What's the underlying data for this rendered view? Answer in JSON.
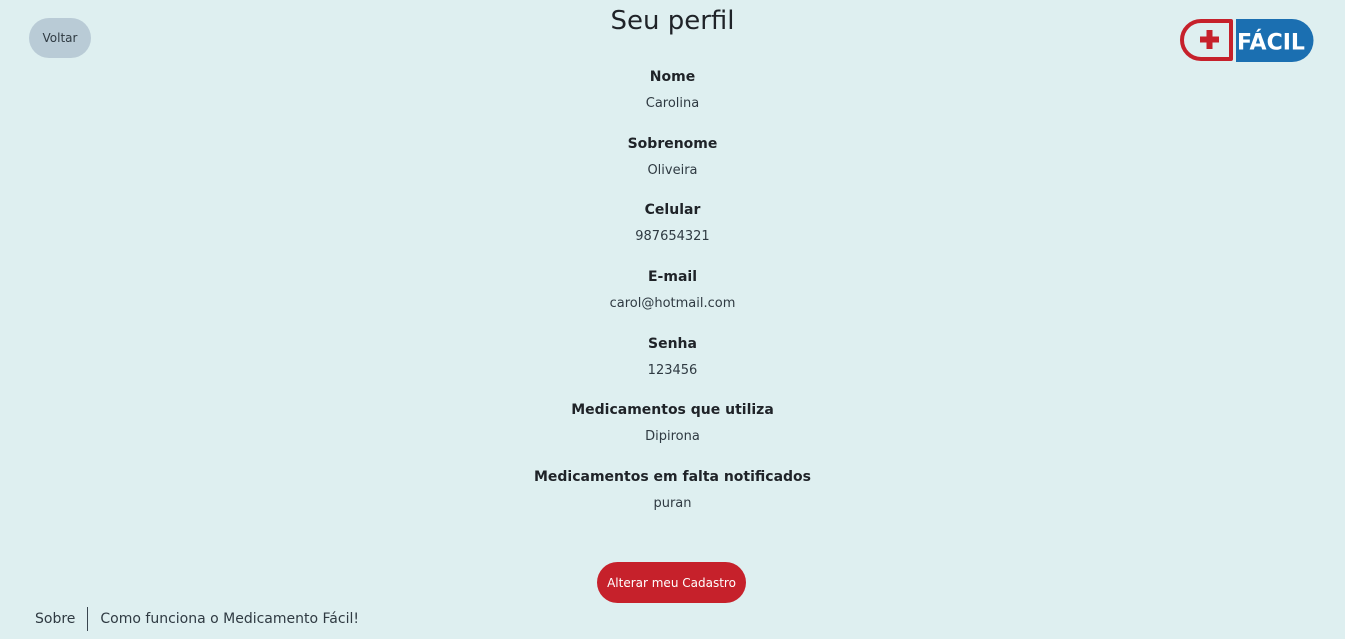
{
  "header": {
    "back_label": "Voltar",
    "title": "Seu perfil",
    "logo_text": "FÁCIL",
    "logo_icon": "plus-cross-icon"
  },
  "profile": {
    "fields": [
      {
        "label": "Nome",
        "value": "Carolina"
      },
      {
        "label": "Sobrenome",
        "value": "Oliveira"
      },
      {
        "label": "Celular",
        "value": "987654321"
      },
      {
        "label": "E-mail",
        "value": "carol@hotmail.com"
      },
      {
        "label": "Senha",
        "value": "123456"
      },
      {
        "label": "Medicamentos que utiliza",
        "value": "Dipirona"
      },
      {
        "label": "Medicamentos em falta notificados",
        "value": "puran"
      }
    ],
    "edit_label": "Alterar meu Cadastro"
  },
  "footer": {
    "links": [
      "Sobre",
      "Como funciona o Medicamento Fácil!"
    ]
  },
  "colors": {
    "background": "#deeff0",
    "back_button": "#b9cbd6",
    "primary_red": "#c6212b",
    "logo_blue": "#1b6fb1"
  }
}
